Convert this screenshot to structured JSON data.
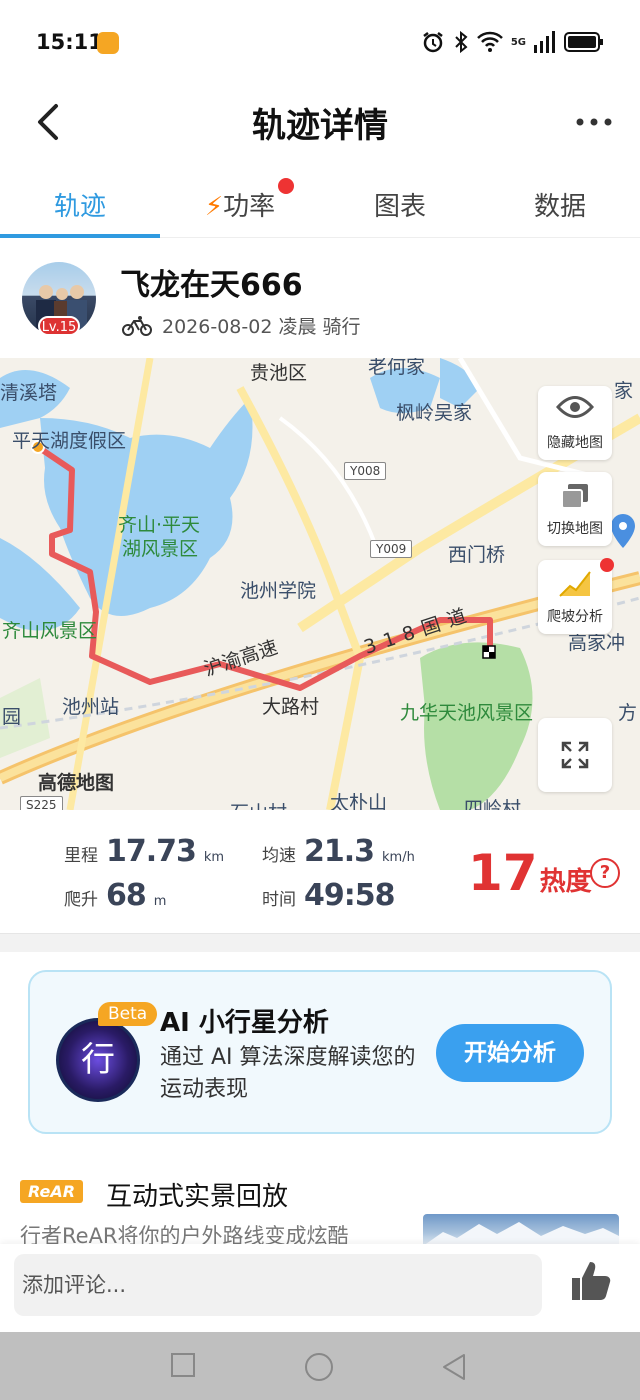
{
  "status_bar": {
    "time": "15:11",
    "network": "5G"
  },
  "header": {
    "title": "轨迹详情"
  },
  "tabs": [
    {
      "label": "轨迹",
      "active": true
    },
    {
      "label": "功率",
      "has_dot": true,
      "icon": "lightning-icon"
    },
    {
      "label": "图表"
    },
    {
      "label": "数据"
    }
  ],
  "profile": {
    "name": "飞龙在天666",
    "level": "Lv.15",
    "meta": "2026-08-02 凌晨 骑行"
  },
  "map": {
    "labels": {
      "l1": "清溪塔",
      "l2": "贵池区",
      "l3": "老何家",
      "l4": "枫岭吴家",
      "l5": "平天湖度假区",
      "l6": "齐山·平天",
      "l7": "湖风景区",
      "l8": "西门桥",
      "l9": "池州学院",
      "l10": "齐山风景区",
      "l11": "沪渝高速",
      "l12": "318国道",
      "l13": "大路村",
      "l14": "九华天池风景区",
      "l15": "池州站",
      "l16": "高德地图",
      "l17": "园",
      "l18": "高家冲",
      "l19": "方",
      "l20": "家",
      "l21": "石山村",
      "l22": "太朴山",
      "l23": "四岭村"
    },
    "road_tags": {
      "r1": "Y008",
      "r2": "Y009",
      "r3": "S225"
    },
    "buttons": {
      "hide_map": "隐藏地图",
      "switch_map": "切换地图",
      "climb_analysis": "爬坡分析"
    }
  },
  "stats": {
    "distance": {
      "label": "里程",
      "value": "17.73",
      "unit": "km"
    },
    "avg_speed": {
      "label": "均速",
      "value": "21.3",
      "unit": "km/h"
    },
    "climb": {
      "label": "爬升",
      "value": "68",
      "unit": "m"
    },
    "time": {
      "label": "时间",
      "value": "49:58"
    },
    "heat": {
      "value": "17",
      "label": "热度"
    }
  },
  "ai_card": {
    "badge": "Beta",
    "logo_char": "行",
    "title": "AI 小行星分析",
    "desc": "通过 AI 算法深度解读您的运动表现",
    "button": "开始分析"
  },
  "rear": {
    "badge": "ReAR",
    "title": "互动式实景回放",
    "desc": "行者ReAR将你的户外路线变成炫酷"
  },
  "comment": {
    "placeholder": "添加评论..."
  },
  "colors": {
    "accent": "#2f9ae0",
    "heat": "#e03333",
    "route": "#e85a5a"
  }
}
